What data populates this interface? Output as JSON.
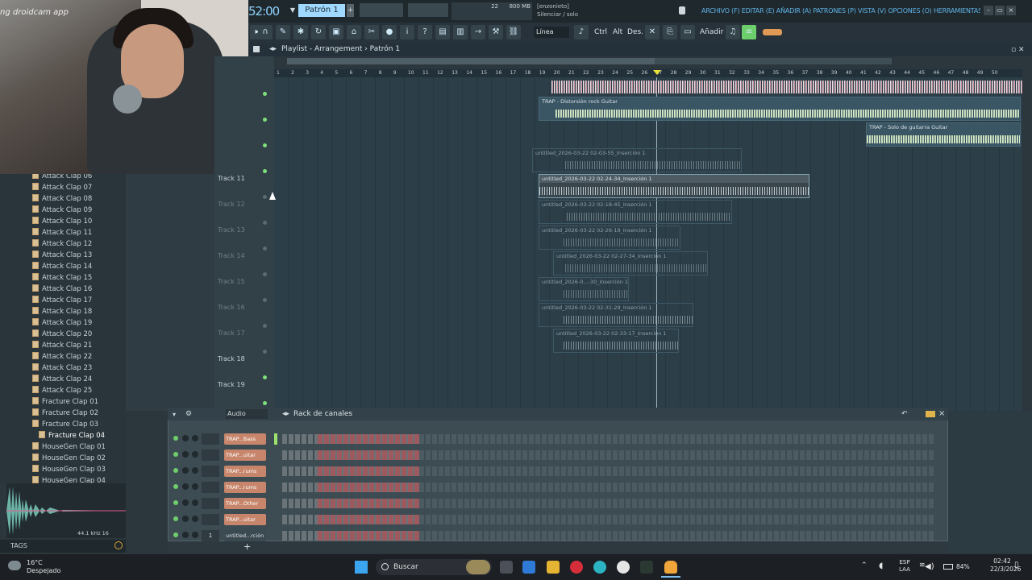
{
  "app": {
    "time": "52:00",
    "pattern": "Patrón 1",
    "cpu": "22",
    "memory": "800 MB",
    "hint_line1": "[enzonieto]",
    "hint_line2": "Silenciar / solo",
    "menu": "ARCHIVO (F) EDITAR (E) AÑADIR (A) PATRONES (P) VISTA (V) OPCIONES (O) HERRAMIENTAS (T) AYUDA"
  },
  "toolbar": {
    "line_mode": "Línea",
    "ctrl": "Ctrl",
    "alt": "Alt",
    "des": "Des.",
    "add": "Añadir"
  },
  "webcam": {
    "overlay": "ng droidcam app"
  },
  "browser": {
    "items": [
      "Attack Clap 06",
      "Attack Clap 07",
      "Attack Clap 08",
      "Attack Clap 09",
      "Attack Clap 10",
      "Attack Clap 11",
      "Attack Clap 12",
      "Attack Clap 13",
      "Attack Clap 14",
      "Attack Clap 15",
      "Attack Clap 16",
      "Attack Clap 17",
      "Attack Clap 18",
      "Attack Clap 19",
      "Attack Clap 20",
      "Attack Clap 21",
      "Attack Clap 22",
      "Attack Clap 23",
      "Attack Clap 24",
      "Attack Clap 25",
      "Fracture Clap 01",
      "Fracture Clap 02",
      "Fracture Clap 03",
      "Fracture Clap 04",
      "HouseGen Clap 01",
      "HouseGen Clap 02",
      "HouseGen Clap 03",
      "HouseGen Clap 04"
    ],
    "selected": "Fracture Clap 04",
    "wave_info": "44.1 kHz 16",
    "tags": "TAGS"
  },
  "playlist": {
    "title": "Playlist - Arrangement › Patrón 1",
    "tracks": [
      "Track 11",
      "Track 12",
      "Track 13",
      "Track 14",
      "Track 15",
      "Track 16",
      "Track 17",
      "Track 18",
      "Track 19"
    ],
    "ruler": [
      "1",
      "2",
      "3",
      "4",
      "5",
      "6",
      "7",
      "8",
      "9",
      "10",
      "11",
      "12",
      "13",
      "14",
      "15",
      "16",
      "17",
      "18",
      "19",
      "20",
      "21",
      "22",
      "23",
      "24",
      "25",
      "26",
      "27",
      "28",
      "29",
      "30",
      "31",
      "32",
      "33",
      "34",
      "35",
      "36",
      "37",
      "38",
      "39",
      "40",
      "41",
      "42",
      "43",
      "44",
      "45",
      "46",
      "47",
      "48",
      "49",
      "50"
    ],
    "clips": [
      {
        "label": "TRAP - Distorsión rock Guitar"
      },
      {
        "label": "TRAP - Solo de guitarra Guitar"
      },
      {
        "label": "untitled_2026-03-22 02-03-55_Inserción 1"
      },
      {
        "label": "untitled_2026-03-22 02-24-34_Inserción 1"
      },
      {
        "label": "untitled_2026-03-22 02-18-45_Inserción 1"
      },
      {
        "label": "untitled_2026-03-22 02-26-19_Inserción 1"
      },
      {
        "label": "untitled_2026-03-22 02-27-34_Inserción 1"
      },
      {
        "label": "untitled_2026-0...-30_Inserción 1"
      },
      {
        "label": "untitled_2026-03-22 02-31-29_Inserción 1"
      },
      {
        "label": "untitled_2026-03-22 02-33-17_Inserción 1"
      }
    ]
  },
  "rack": {
    "audio": "Audio",
    "title": "Rack de canales",
    "channels": [
      "TRAP...Bass",
      "TRAP...uitar",
      "TRAP...rums",
      "TRAP...rums",
      "TRAP...Other",
      "TRAP...uitar",
      "untitled...rción 1"
    ],
    "last_num": "1"
  },
  "taskbar": {
    "temp": "16°C",
    "weather": "Despejado",
    "search": "Buscar",
    "lang1": "ESP",
    "lang2": "LAA",
    "battery": "84%",
    "time": "02:42",
    "date": "22/3/2026"
  }
}
